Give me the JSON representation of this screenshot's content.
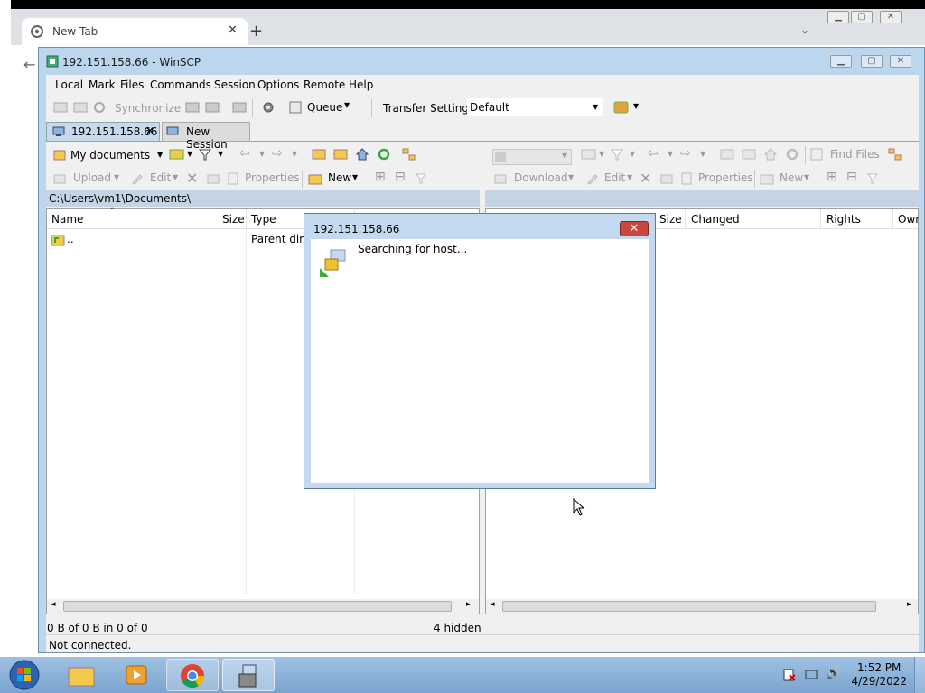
{
  "browser": {
    "tab_title": "New Tab",
    "new_tab_icon": "plus-icon"
  },
  "winscp": {
    "title": "192.151.158.66 - WinSCP",
    "menu": [
      "Local",
      "Mark",
      "Files",
      "Commands",
      "Session",
      "Options",
      "Remote",
      "Help"
    ],
    "toolbar": {
      "synchronize": "Synchronize",
      "queue": "Queue",
      "transfer_settings_label": "Transfer Settings",
      "transfer_settings_value": "Default"
    },
    "session_tabs": [
      "192.151.158.66",
      "New Session"
    ],
    "local": {
      "location": "My documents",
      "upload": "Upload",
      "edit": "Edit",
      "properties": "Properties",
      "new": "New",
      "path": "C:\\Users\\vm1\\Documents\\",
      "columns": [
        "Name",
        "Size",
        "Type"
      ],
      "rows": [
        {
          "name": "..",
          "type": "Parent direc"
        }
      ]
    },
    "remote": {
      "find_files": "Find Files",
      "download": "Download",
      "edit": "Edit",
      "properties": "Properties",
      "new": "New",
      "columns": [
        "Size",
        "Changed",
        "Rights",
        "Owr"
      ]
    },
    "status": {
      "selection": "0 B of 0 B in 0 of 0",
      "hidden": "4 hidden",
      "connection": "Not connected."
    }
  },
  "dialog": {
    "title": "192.151.158.66",
    "message": "Searching for host...",
    "close_label": "✕"
  },
  "taskbar": {
    "time": "1:52 PM",
    "date": "4/29/2022"
  },
  "colors": {
    "winscp_frame": "#bcd6ee",
    "taskbar": "#7aa4cf",
    "close_button": "#c9473b"
  }
}
